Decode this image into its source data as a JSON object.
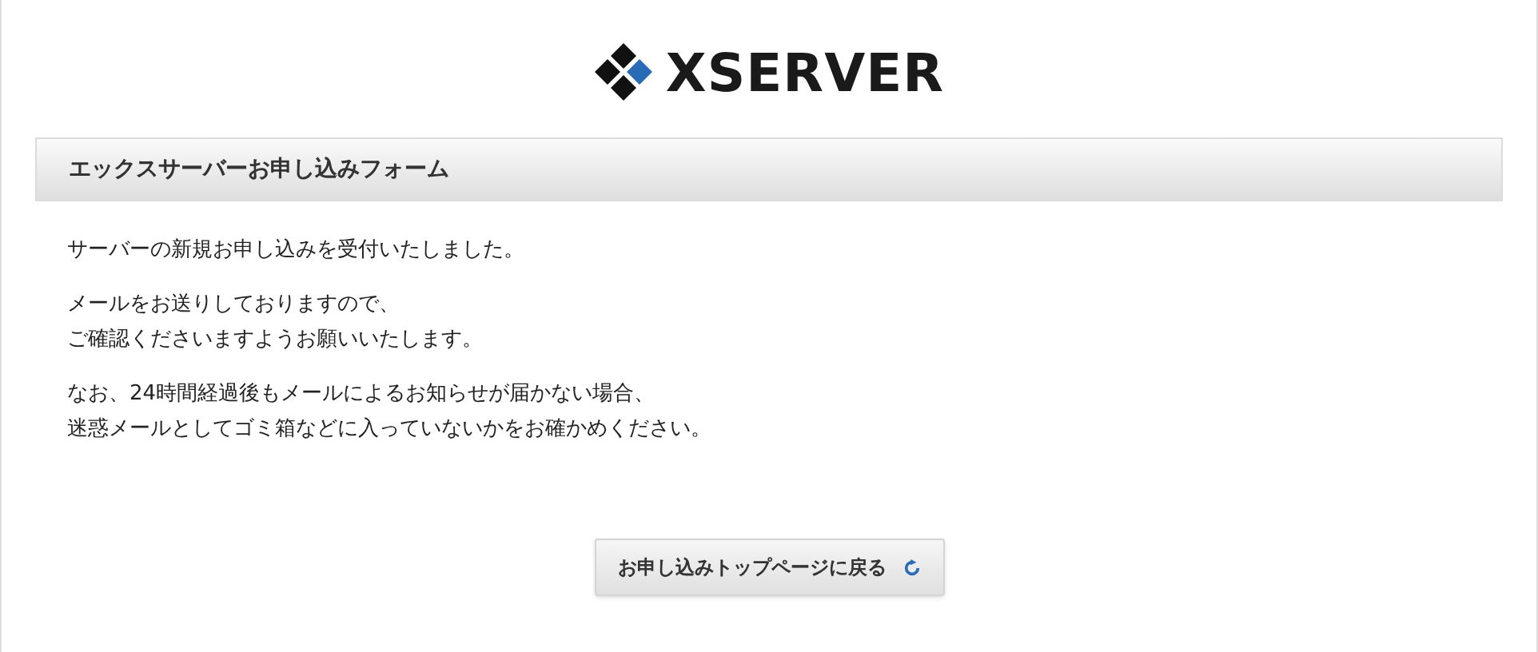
{
  "logo": {
    "text": "XSERVER"
  },
  "panel": {
    "title": "エックスサーバーお申し込みフォーム",
    "paragraphs": [
      [
        "サーバーの新規お申し込みを受付いたしました。"
      ],
      [
        "メールをお送りしておりますので、",
        "ご確認くださいますようお願いいたします。"
      ],
      [
        "なお、24時間経過後もメールによるお知らせが届かない場合、",
        "迷惑メールとしてゴミ箱などに入っていないかをお確かめください。"
      ]
    ]
  },
  "button": {
    "label": "お申し込みトップページに戻る"
  }
}
